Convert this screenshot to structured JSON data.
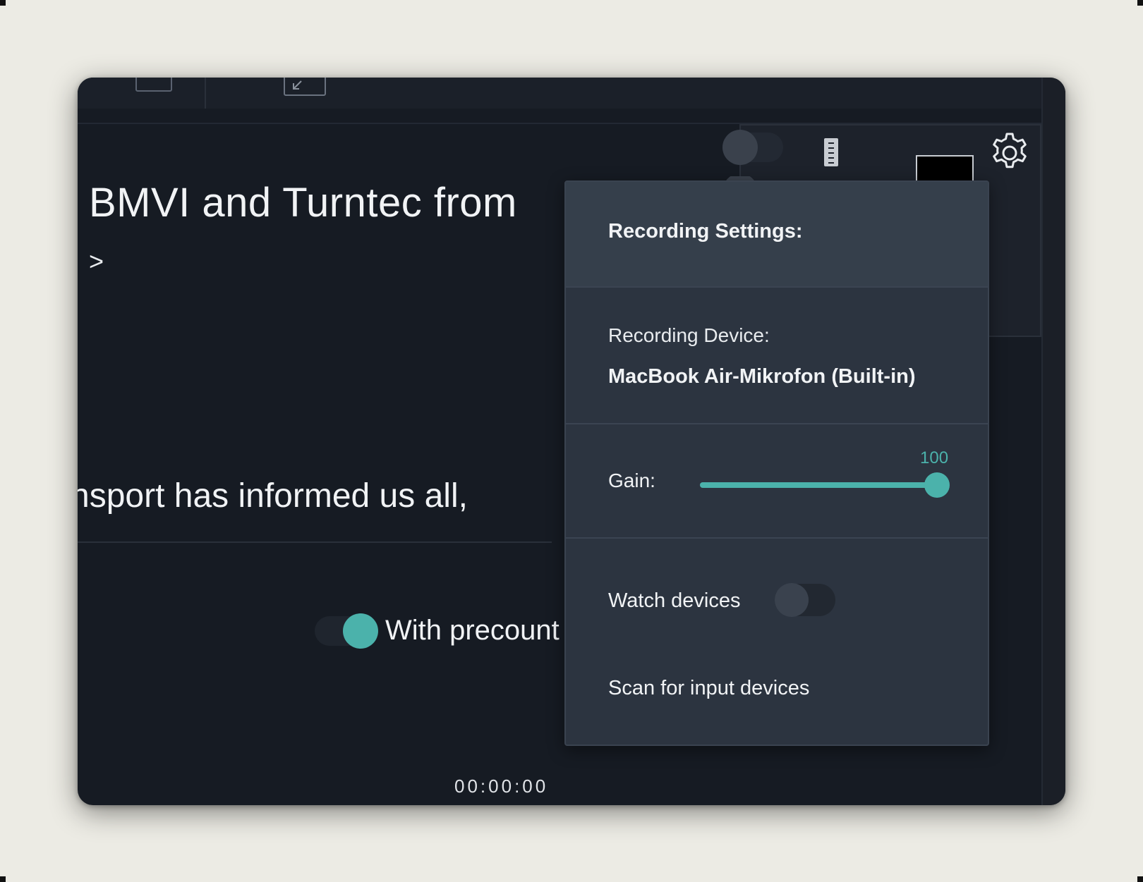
{
  "background_window": {
    "title_line": "BMVI and Turntec from",
    "chevron_glyph": ">",
    "body_line": "nsport has informed us all,",
    "precount_label": "With precount",
    "precount_enabled": true,
    "time_readout": "00:00:00"
  },
  "recording_settings": {
    "title": "Recording Settings:",
    "device_label": "Recording Device:",
    "device_value": "MacBook Air-Mikrofon (Built-in)",
    "gain_label": "Gain:",
    "gain_value": "100",
    "gain_max": 100,
    "watch_devices_label": "Watch devices",
    "watch_devices_enabled": false,
    "scan_label": "Scan for input devices"
  },
  "icons": {
    "settings": "gear-icon",
    "ruler": "ruler-icon",
    "collapse": "arrow-down-left-icon"
  },
  "colors": {
    "accent": "#4bb2ab",
    "window_bg": "#161b23",
    "popup_bg": "#2c3440",
    "popup_header_bg": "#353f4b",
    "page_bg": "#ecebe4"
  }
}
